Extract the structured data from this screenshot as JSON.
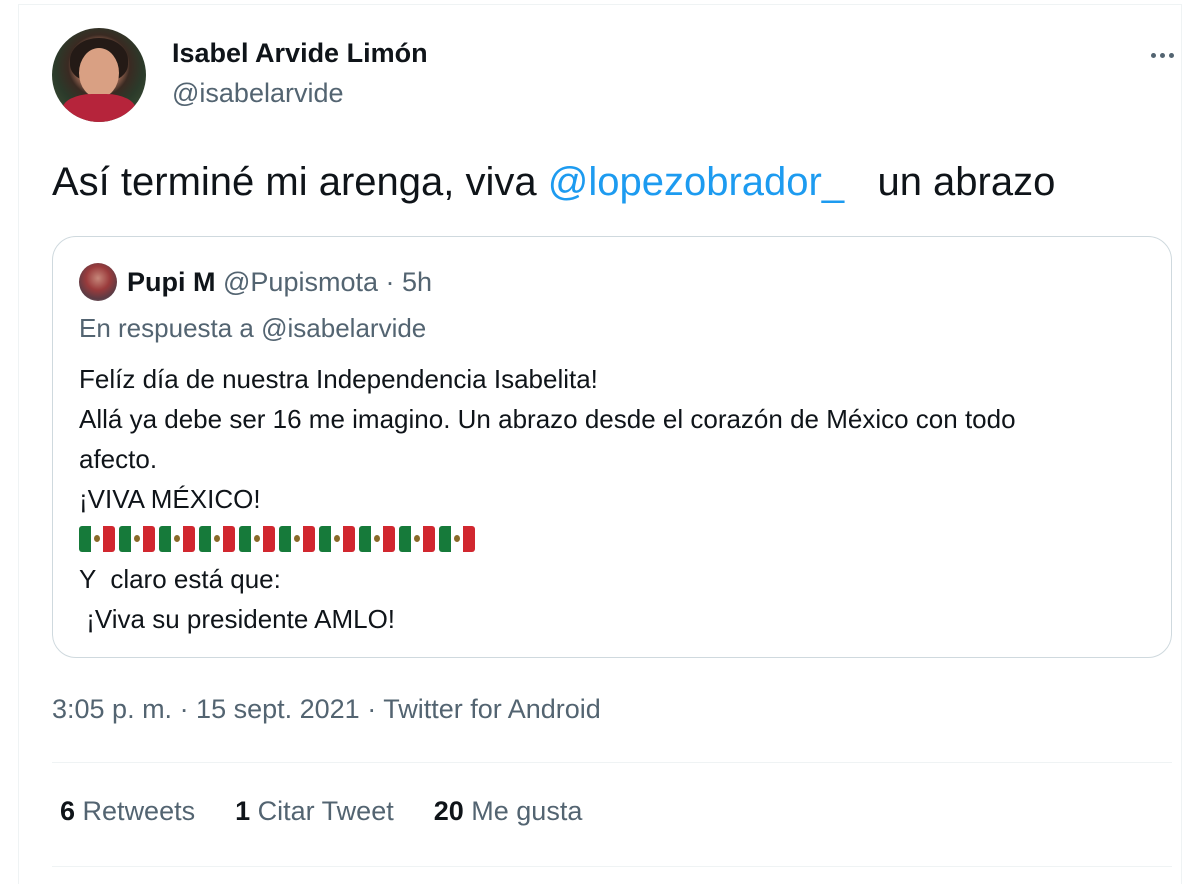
{
  "author": {
    "name": "Isabel Arvide Limón",
    "handle": "@isabelarvide"
  },
  "tweet": {
    "text_before": "Así terminé mi arenga, viva ",
    "mention": "@lopezobrador_",
    "text_after": "   un abrazo"
  },
  "quote": {
    "name": "Pupi M",
    "meta": "@Pupismota · 5h",
    "reply_prefix": "En respuesta a ",
    "reply_handle": "@isabelarvide",
    "lines": [
      "Felíz día de nuestra Independencia Isabelita!",
      "Allá ya debe ser 16 me imagino. Un abrazo desde el corazón de México con todo",
      "afecto.",
      "¡VIVA MÉXICO!"
    ],
    "flag_emoji_count": 10,
    "lines_after": [
      "Y  claro está que:",
      " ¡Viva su presidente AMLO!"
    ]
  },
  "timestamp": "3:05 p. m. · 15 sept. 2021 · Twitter for Android",
  "stats": {
    "retweets_count": "6",
    "retweets_label": "Retweets",
    "quotes_count": "1",
    "quotes_label": "Citar Tweet",
    "likes_count": "20",
    "likes_label": "Me gusta"
  },
  "icons": {
    "more": "more-horizontal-icon",
    "flag": "mexico-flag-emoji"
  },
  "colors": {
    "link": "#1d9bf0",
    "secondary_text": "#536471",
    "border": "#cfd9de"
  }
}
